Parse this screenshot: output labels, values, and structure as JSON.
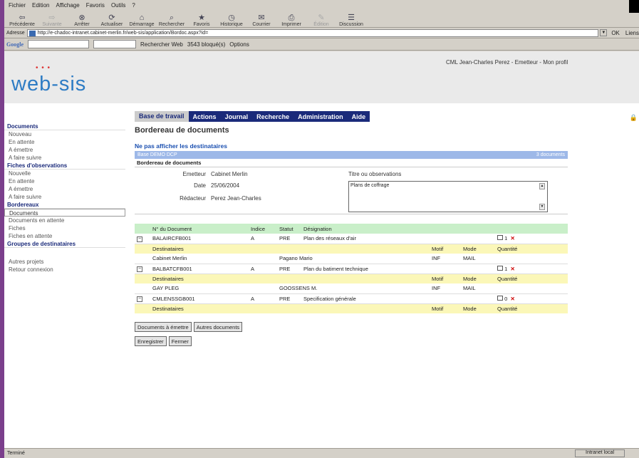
{
  "menu": [
    "Fichier",
    "Edition",
    "Affichage",
    "Favoris",
    "Outils",
    "?"
  ],
  "toolbar": [
    {
      "label": "Précédente",
      "icon": "back-icon"
    },
    {
      "label": "Suivante",
      "icon": "forward-icon",
      "disabled": true
    },
    {
      "label": "Arrêter",
      "icon": "stop-icon"
    },
    {
      "label": "Actualiser",
      "icon": "refresh-icon"
    },
    {
      "label": "Démarrage",
      "icon": "home-icon"
    },
    {
      "label": "Rechercher",
      "icon": "search-icon"
    },
    {
      "label": "Favoris",
      "icon": "favorites-icon"
    },
    {
      "label": "Historique",
      "icon": "history-icon"
    },
    {
      "label": "Courrier",
      "icon": "mail-icon"
    },
    {
      "label": "Imprimer",
      "icon": "print-icon"
    },
    {
      "label": "Édition",
      "icon": "edit-icon",
      "disabled": true
    },
    {
      "label": "Discussion",
      "icon": "discuss-icon"
    }
  ],
  "address": {
    "label": "Adresse",
    "url": "http://e-chadoc-intranet.cabinet-merlin.fr/web-sis/application/Bordoc.aspx?id=",
    "go": "OK",
    "links": "Liens"
  },
  "google": {
    "logo": "Google",
    "search_btn": "Rechercher Web",
    "blocked": "3543 bloqué(s)",
    "options": "Options"
  },
  "user": "CML Jean-Charles Perez - Emetteur - Mon profil",
  "logo": "web-sis",
  "nav": [
    "Base de travail",
    "Actions",
    "Journal",
    "Recherche",
    "Administration",
    "Aide"
  ],
  "sidebar": [
    {
      "head": "Documents",
      "items": [
        "Nouveau",
        "En attente",
        "A émettre",
        "A faire suivre"
      ]
    },
    {
      "head": "Fiches d'observations",
      "items": [
        "Nouvelle",
        "En attente",
        "A émettre",
        "A faire suivre"
      ]
    },
    {
      "head": "Bordereaux",
      "items": [
        "Documents",
        "Documents en attente",
        "Fiches",
        "Fiches en attente"
      ]
    },
    {
      "head": "Groupes de destinataires",
      "items": []
    }
  ],
  "sidebar_extra": [
    "Autres projets",
    "Retour connexion"
  ],
  "page_title": "Bordereau de documents",
  "hide_link": "Ne pas afficher les destinataires",
  "bluebar": {
    "left": "Base DEMO DCP",
    "right": "3 documents"
  },
  "section": "Bordereau de documents",
  "form": {
    "emetteur_lbl": "Emetteur",
    "emetteur": "Cabinet Merlin",
    "date_lbl": "Date",
    "date": "25/06/2004",
    "redacteur_lbl": "Rédacteur",
    "redacteur": "Perez Jean-Charles",
    "obs_lbl": "Titre ou observations",
    "obs": "Plans de coffrage"
  },
  "table": {
    "headers": [
      "N° du Document",
      "Indice",
      "Statut",
      "Désignation"
    ],
    "sub_headers": [
      "Destinataires",
      "Motif",
      "Mode",
      "Quantité"
    ],
    "docs": [
      {
        "num": "BALAIRCFB001",
        "indice": "A",
        "statut": "PRE",
        "desig": "Plan des réseaux d'air",
        "qty": "1",
        "dests": [
          {
            "org": "Cabinet Merlin",
            "person": "Pagano Mario",
            "motif": "INF",
            "mode": "MAIL"
          }
        ]
      },
      {
        "num": "BALBATCFB001",
        "indice": "A",
        "statut": "PRE",
        "desig": "Plan du batiment technique",
        "qty": "1",
        "dests": [
          {
            "org": "GAY PLEG",
            "person": "GOOSSENS M.",
            "motif": "INF",
            "mode": "MAIL"
          }
        ]
      },
      {
        "num": "CMLENSSGB001",
        "indice": "A",
        "statut": "PRE",
        "desig": "Specification générale",
        "qty": "0",
        "dests": []
      }
    ]
  },
  "buttons": [
    "Documents à émettre",
    "Autres documents",
    "Enregistrer",
    "Fermer"
  ],
  "status": {
    "left": "Terminé",
    "zone": "Intranet local"
  }
}
